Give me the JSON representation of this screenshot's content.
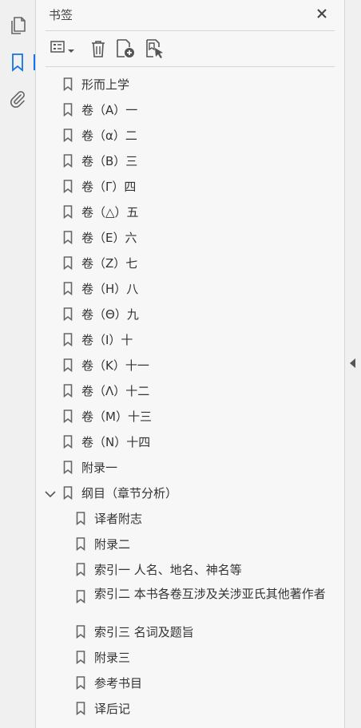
{
  "panel": {
    "title": "书签"
  },
  "bookmarks": [
    {
      "label": "形而上学",
      "level": 1
    },
    {
      "label": "卷（A）一",
      "level": 1
    },
    {
      "label": "卷（α）二",
      "level": 1
    },
    {
      "label": "卷（B）三",
      "level": 1
    },
    {
      "label": "卷（Γ）四",
      "level": 1
    },
    {
      "label": "卷（△）五",
      "level": 1
    },
    {
      "label": "卷（E）六",
      "level": 1
    },
    {
      "label": "卷（Z）七",
      "level": 1
    },
    {
      "label": "卷（H）八",
      "level": 1
    },
    {
      "label": "卷（Θ）九",
      "level": 1
    },
    {
      "label": "卷（I）十",
      "level": 1
    },
    {
      "label": "卷（K）十一",
      "level": 1
    },
    {
      "label": "卷（Λ）十二",
      "level": 1
    },
    {
      "label": "卷（M）十三",
      "level": 1
    },
    {
      "label": "卷（N）十四",
      "level": 1
    },
    {
      "label": "附录一",
      "level": 1
    },
    {
      "label": "纲目（章节分析）",
      "level": 1,
      "expanded": true
    },
    {
      "label": "译者附志",
      "level": 2
    },
    {
      "label": "附录二",
      "level": 2
    },
    {
      "label": "索引一 人名、地名、神名等",
      "level": 2
    },
    {
      "label": "索引二 本书各卷互涉及关涉亚氏其他著作者",
      "level": 2
    },
    {
      "label": "索引三 名词及题旨",
      "level": 2
    },
    {
      "label": "附录三",
      "level": 2
    },
    {
      "label": "参考书目",
      "level": 2
    },
    {
      "label": "译后记",
      "level": 2
    }
  ],
  "icons": {
    "rail": [
      "pages-icon",
      "bookmark-panel-icon",
      "attachment-icon"
    ],
    "toolbar": [
      "options-list-icon",
      "delete-icon",
      "new-bookmark-icon",
      "bookmark-from-selection-icon"
    ]
  },
  "colors": {
    "accent": "#1473e6",
    "icon": "#666666",
    "background": "#f7f7f7"
  }
}
